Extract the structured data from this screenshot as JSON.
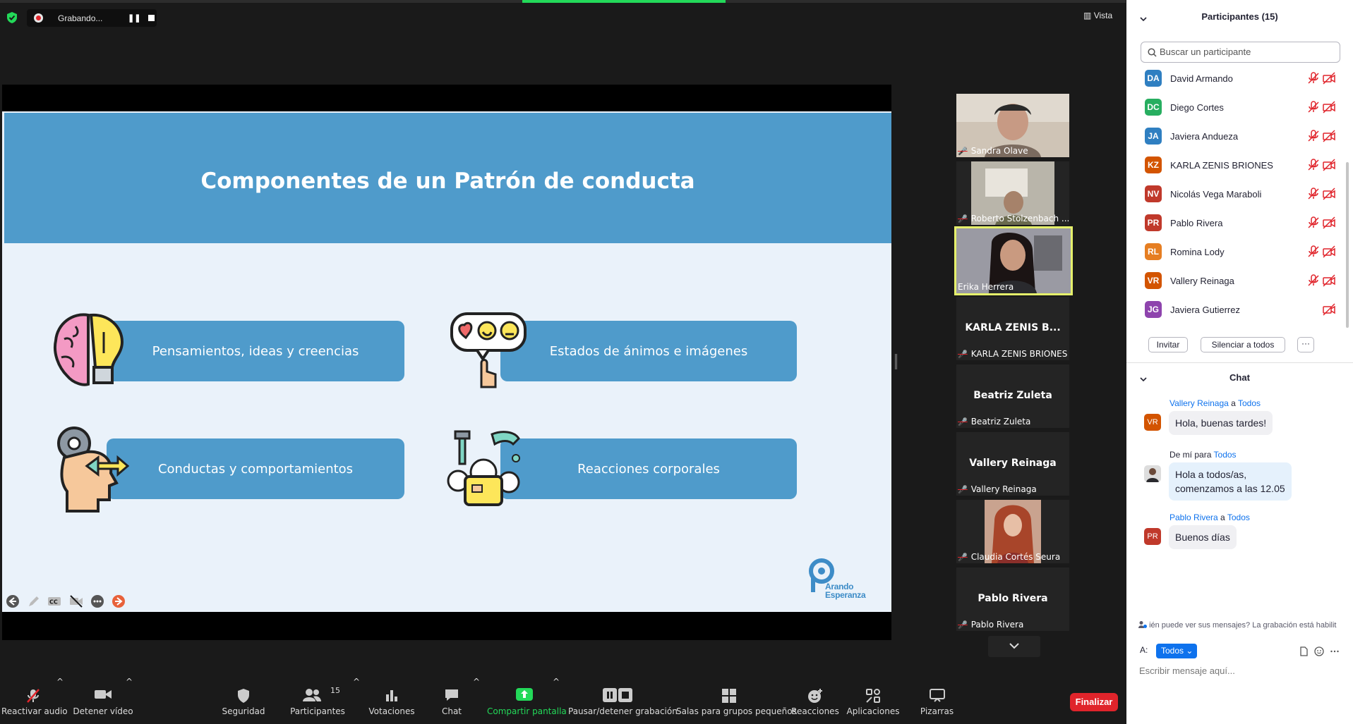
{
  "recording": {
    "label": "Grabando...",
    "pause_glyph": "❚❚"
  },
  "view": {
    "label": "Vista",
    "glyph": "▥"
  },
  "slide": {
    "title": "Componentes de un Patrón de conducta",
    "items": [
      {
        "text": "Pensamientos, ideas y creencias",
        "icon": "brain-lightbulb-icon"
      },
      {
        "text": "Estados de ánimos e imágenes",
        "icon": "emoji-feedback-icon"
      },
      {
        "text": "Conductas y comportamientos",
        "icon": "head-gear-icon"
      },
      {
        "text": "Reacciones corporales",
        "icon": "lab-flask-icon"
      }
    ],
    "logo_line1": "Arando",
    "logo_line2": "Esperanza"
  },
  "gallery": [
    {
      "name": "Sandra Olave",
      "video": true
    },
    {
      "name": "Roberto Stolzenbach ...",
      "video": true
    },
    {
      "name": "Erika Herrera",
      "video": true,
      "active": true
    },
    {
      "name": "KARLA ZENIS BRIONES",
      "big": "KARLA ZENIS B...",
      "video": false
    },
    {
      "name": "Beatriz Zuleta",
      "big": "Beatriz Zuleta",
      "video": false
    },
    {
      "name": "Vallery Reinaga",
      "big": "Vallery Reinaga",
      "video": false
    },
    {
      "name": "Claudia Cortés Seura",
      "video": true
    },
    {
      "name": "Pablo Rivera",
      "big": "Pablo Rivera",
      "video": false
    }
  ],
  "toolbar": {
    "audio": "Reactivar audio",
    "video": "Detener vídeo",
    "security": "Seguridad",
    "participants": "Participantes",
    "participants_count": "15",
    "polls": "Votaciones",
    "chat": "Chat",
    "share": "Compartir pantalla",
    "record": "Pausar/detener grabación",
    "breakout": "Salas para grupos pequeños",
    "reactions": "Reacciones",
    "apps": "Aplicaciones",
    "whiteboards": "Pizarras",
    "end": "Finalizar"
  },
  "participants_panel": {
    "title": "Participantes (15)",
    "search_placeholder": "Buscar un participante",
    "list": [
      {
        "initials": "DA",
        "name": "David Armando",
        "color": "#2f7fc1",
        "mic": true
      },
      {
        "initials": "DC",
        "name": "Diego Cortes",
        "color": "#27ae60",
        "mic": true
      },
      {
        "initials": "JA",
        "name": "Javiera Andueza",
        "color": "#2f7fc1",
        "mic": true
      },
      {
        "initials": "KZ",
        "name": "KARLA ZENIS BRIONES",
        "color": "#d35400",
        "mic": true
      },
      {
        "initials": "NV",
        "name": "Nicolás Vega Maraboli",
        "color": "#c0392b",
        "mic": true
      },
      {
        "initials": "PR",
        "name": "Pablo Rivera",
        "color": "#c0392b",
        "mic": true
      },
      {
        "initials": "RL",
        "name": "Romina Lody",
        "color": "#e67e22",
        "mic": true
      },
      {
        "initials": "VR",
        "name": "Vallery Reinaga",
        "color": "#d35400",
        "mic": true
      },
      {
        "initials": "JG",
        "name": "Javiera Gutierrez",
        "color": "#8e44ad",
        "mic": false
      }
    ],
    "invite": "Invitar",
    "mute_all": "Silenciar a todos",
    "more": "···"
  },
  "chat_panel": {
    "title": "Chat",
    "messages": [
      {
        "from": "Vallery Reinaga",
        "to_word": "a",
        "to": "Todos",
        "avatar": "VR",
        "color": "#d35400",
        "text": "Hola, buenas tardes!"
      },
      {
        "from": "De mí",
        "to_word": "para",
        "to": "Todos",
        "avatar": "",
        "color": "#6d6d6d",
        "text": "Hola a todos/as,\ncomenzamos a las 12.05"
      },
      {
        "from": "Pablo Rivera",
        "to_word": "a",
        "to": "Todos",
        "avatar": "PR",
        "color": "#c0392b",
        "text": "Buenos días"
      }
    ],
    "notice": "ién puede ver sus mensajes? La grabación está habilit",
    "to_label": "A:",
    "to_value": "Todos",
    "input_placeholder": "Escribir mensaje aquí..."
  }
}
